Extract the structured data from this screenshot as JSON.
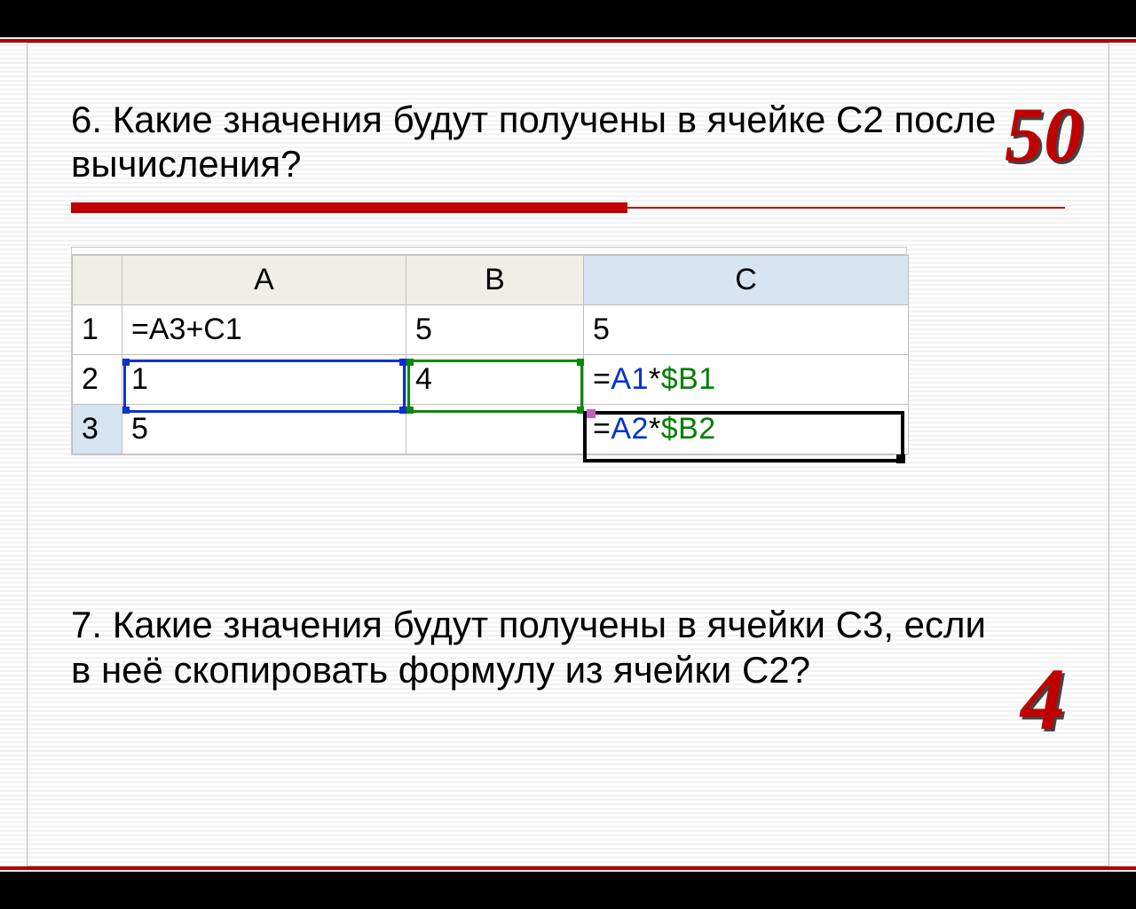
{
  "question6": {
    "text": "6. Какие значения будут получены в ячейке С2 после вычисления?",
    "score": "50"
  },
  "question7": {
    "text": "7. Какие значения будут получены в ячейки С3, если в неё скопировать формулу из ячейки С2?",
    "score": "4"
  },
  "spreadsheet": {
    "columns": {
      "A": "A",
      "B": "B",
      "C": "C"
    },
    "rows": {
      "r1": {
        "num": "1",
        "A": "=A3+C1",
        "B": "5",
        "C": "5"
      },
      "r2": {
        "num": "2",
        "A": "1",
        "B": "4",
        "C": "=A1*$B1"
      },
      "r3": {
        "num": "3",
        "A": "5",
        "B": "",
        "C": "=A2*$B2"
      }
    },
    "c2_formula_parts": {
      "eq": "=",
      "ref1": "A1",
      "op": "*",
      "ref2": "$B1"
    },
    "c3_formula_parts": {
      "eq": "=",
      "ref1": "A2",
      "op": "*",
      "ref2": "$B2"
    },
    "selected_cell": "C3",
    "highlight_a": "A2",
    "highlight_b": "B2"
  }
}
